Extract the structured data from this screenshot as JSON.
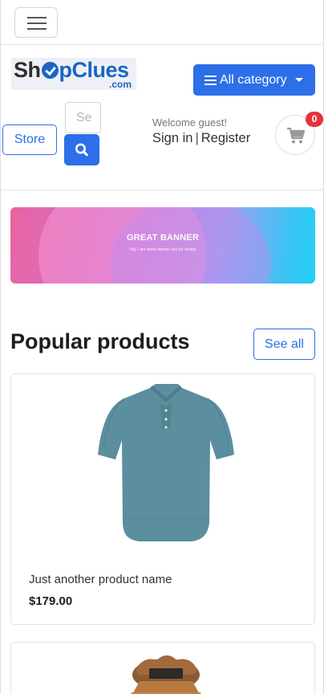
{
  "navbar": {
    "toggler_icon": "hamburger-icon"
  },
  "logo": {
    "main_left": "Sh",
    "main_right": "pClues",
    "sub": ".com",
    "mark_icon": "check-circle-icon"
  },
  "category_button": {
    "label": "All category",
    "icon": "bars-icon",
    "caret": "caret-down-icon"
  },
  "store_button": {
    "label": "Store"
  },
  "search": {
    "placeholder": "Search",
    "value": "Se",
    "icon": "search-icon"
  },
  "account": {
    "welcome": "Welcome guest!",
    "sign_in": "Sign in",
    "separator": "|",
    "register": "Register"
  },
  "cart": {
    "icon": "shopping-cart-icon",
    "count": "0"
  },
  "banner": {
    "title": "GREAT BANNER",
    "subtitle": "Hey I am demo banner just for design"
  },
  "popular": {
    "title": "Popular products",
    "see_all": "See all",
    "products": [
      {
        "name": "Just another product name",
        "price": "$179.00",
        "image": "teal-polo-shirt"
      },
      {
        "name": "",
        "price": "",
        "image": "brown-fur-hood-jacket"
      }
    ]
  },
  "colors": {
    "primary": "#2c6fe8",
    "badge": "#e5323e",
    "shirt": "#5b8e9e"
  }
}
